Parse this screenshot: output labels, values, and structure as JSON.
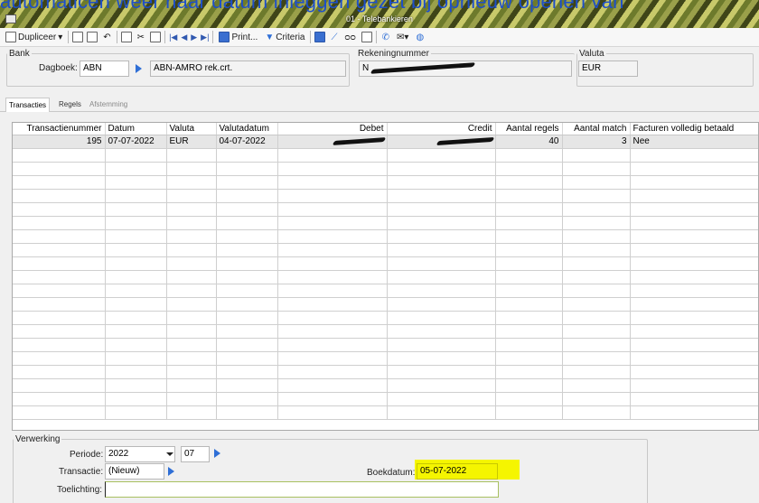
{
  "caption_overlay": "automaticen weer naar datum inleggen gezet bij opnieuw openen van",
  "window_title": "01 - Telebankieren",
  "toolbar": {
    "duplicate": "Dupliceer",
    "print": "Print...",
    "criteria": "Criteria"
  },
  "bank": {
    "legend": "Bank",
    "dagboek_label": "Dagboek:",
    "dagboek_code": "ABN",
    "dagboek_name": "ABN-AMRO rek.crt.",
    "rekening_label": "Rekeningnummer",
    "rekening_value": "N",
    "valuta_label": "Valuta",
    "valuta_value": "EUR"
  },
  "tabs": [
    "Transacties",
    "Regels",
    "Afstemming"
  ],
  "grid": {
    "columns": [
      "Transactienummer",
      "Datum",
      "Valuta",
      "Valutadatum",
      "Debet",
      "Credit",
      "Aantal regels",
      "Aantal match",
      "Facturen volledig betaald"
    ],
    "rows": [
      {
        "transactienummer": "195",
        "datum": "07-07-2022",
        "valuta": "EUR",
        "valutadatum": "04-07-2022",
        "debet": "",
        "credit": "",
        "aantal_regels": "40",
        "aantal_match": "3",
        "facturen": "Nee"
      }
    ]
  },
  "verwerking": {
    "legend": "Verwerking",
    "periode_label": "Periode:",
    "periode_year": "2022",
    "periode_num": "07",
    "transactie_label": "Transactie:",
    "transactie_value": "(Nieuw)",
    "boekdatum_label": "Boekdatum:",
    "boekdatum_value": "05-07-2022",
    "toelichting_label": "Toelichting:",
    "toelichting_value": ""
  },
  "colors": {
    "highlight": "#f5f500",
    "accent": "#2f6fd6",
    "caption": "#1e4fc8"
  }
}
